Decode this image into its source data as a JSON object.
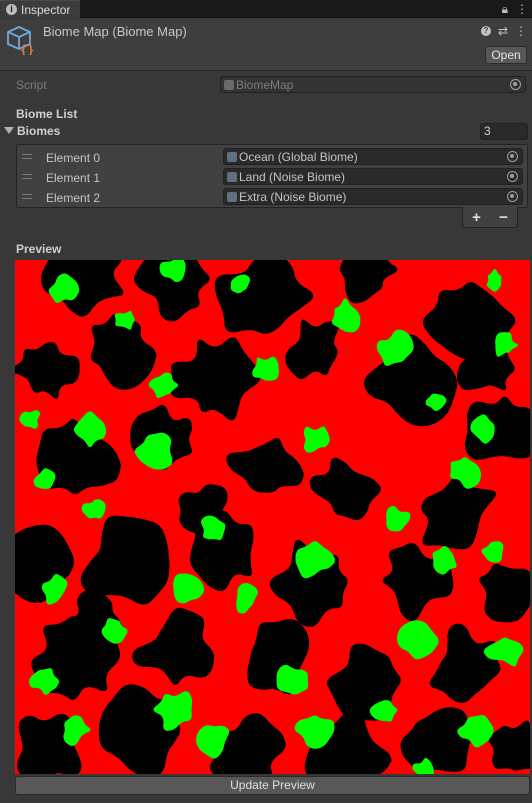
{
  "tab": {
    "label": "Inspector"
  },
  "header": {
    "title": "Biome Map (Biome Map)",
    "open_label": "Open"
  },
  "script_row": {
    "label": "Script",
    "value": "BiomeMap"
  },
  "biome_list": {
    "section_label": "Biome List",
    "array_label": "Biomes",
    "count": "3",
    "elements": [
      {
        "label": "Element 0",
        "value": "Ocean (Global Biome)"
      },
      {
        "label": "Element 1",
        "value": "Land (Noise Biome)"
      },
      {
        "label": "Element 2",
        "value": "Extra (Noise Biome)"
      }
    ],
    "add_label": "+",
    "remove_label": "−"
  },
  "preview": {
    "label": "Preview",
    "colors": {
      "ocean": "#000000",
      "land": "#ff0000",
      "extra": "#00ff00"
    },
    "update_label": "Update Preview"
  }
}
